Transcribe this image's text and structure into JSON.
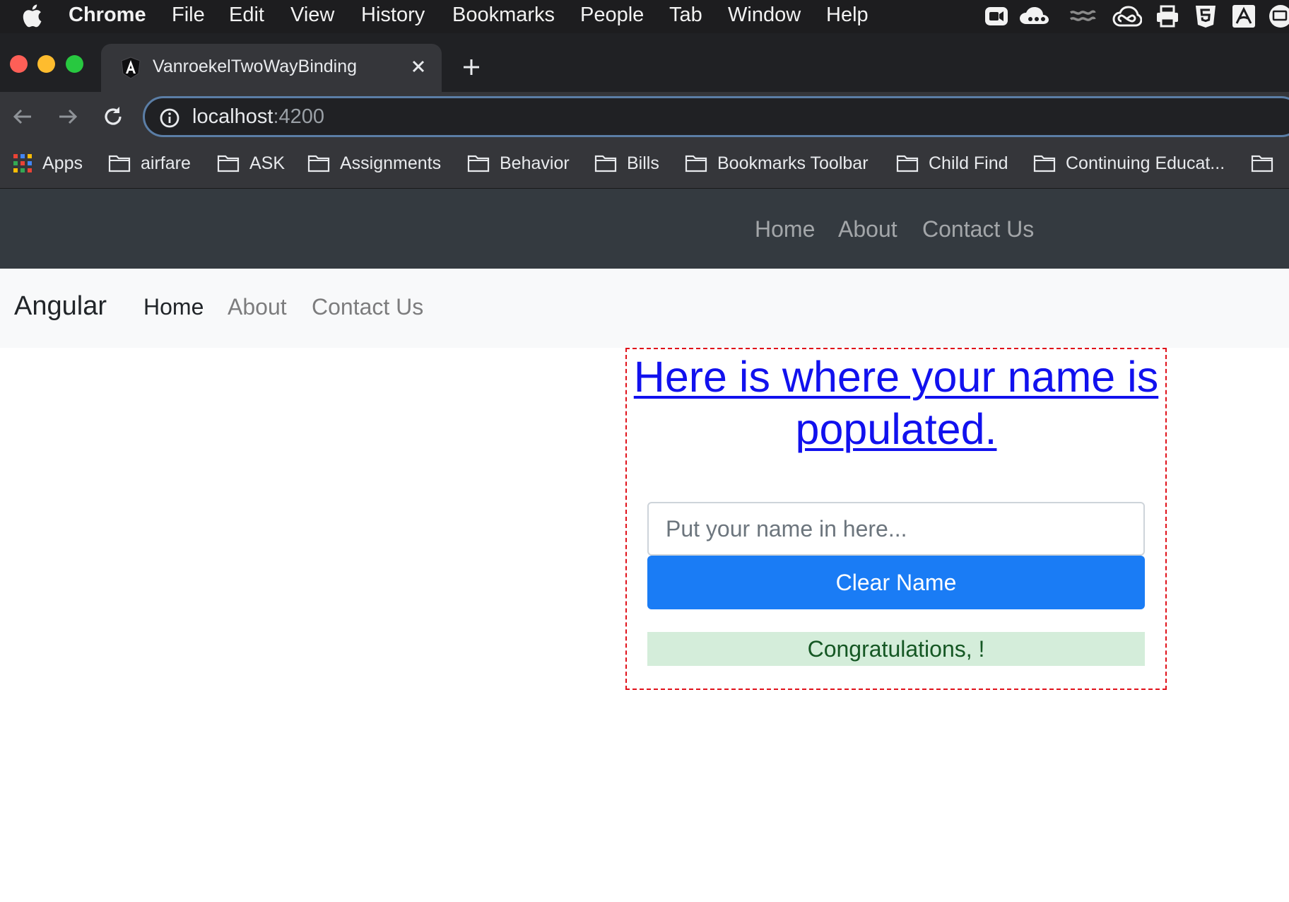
{
  "menubar": {
    "app_name": "Chrome",
    "items": [
      "File",
      "Edit",
      "View",
      "History",
      "Bookmarks",
      "People",
      "Tab",
      "Window",
      "Help"
    ],
    "status_icons": [
      "zoom-icon",
      "creative-cloud-sync-icon",
      "wave-icon",
      "creative-cloud-icon",
      "printer-icon",
      "html5-icon",
      "acrobat-icon",
      "display-icon"
    ]
  },
  "browser": {
    "tab_title": "VanroekelTwoWayBinding",
    "url_host": "localhost",
    "url_port": ":4200",
    "bookmarks": [
      "Apps",
      "airfare",
      "ASK",
      "Assignments",
      "Behavior",
      "Bills",
      "Bookmarks Toolbar",
      "Child Find",
      "Continuing Educat..."
    ]
  },
  "colors": {
    "dark_nav_bg": "#343a40",
    "light_nav_bg": "#f8f9fa",
    "primary_button": "#1a7cf5",
    "success_alert_bg": "#d4edda",
    "success_alert_text": "#155724",
    "heading_link": "#1111ee",
    "dashed_border": "#e0111a"
  },
  "dark_navbar": {
    "links": [
      "Home",
      "About",
      "Contact Us"
    ]
  },
  "light_navbar": {
    "brand": "Angular",
    "links": [
      "Home",
      "About",
      "Contact Us"
    ],
    "active": "Home"
  },
  "main": {
    "heading": "Here is where your name is populated.",
    "name_input": {
      "value": "",
      "placeholder": "Put your name in here..."
    },
    "clear_button": "Clear Name",
    "greeting": "Congratulations, !"
  }
}
